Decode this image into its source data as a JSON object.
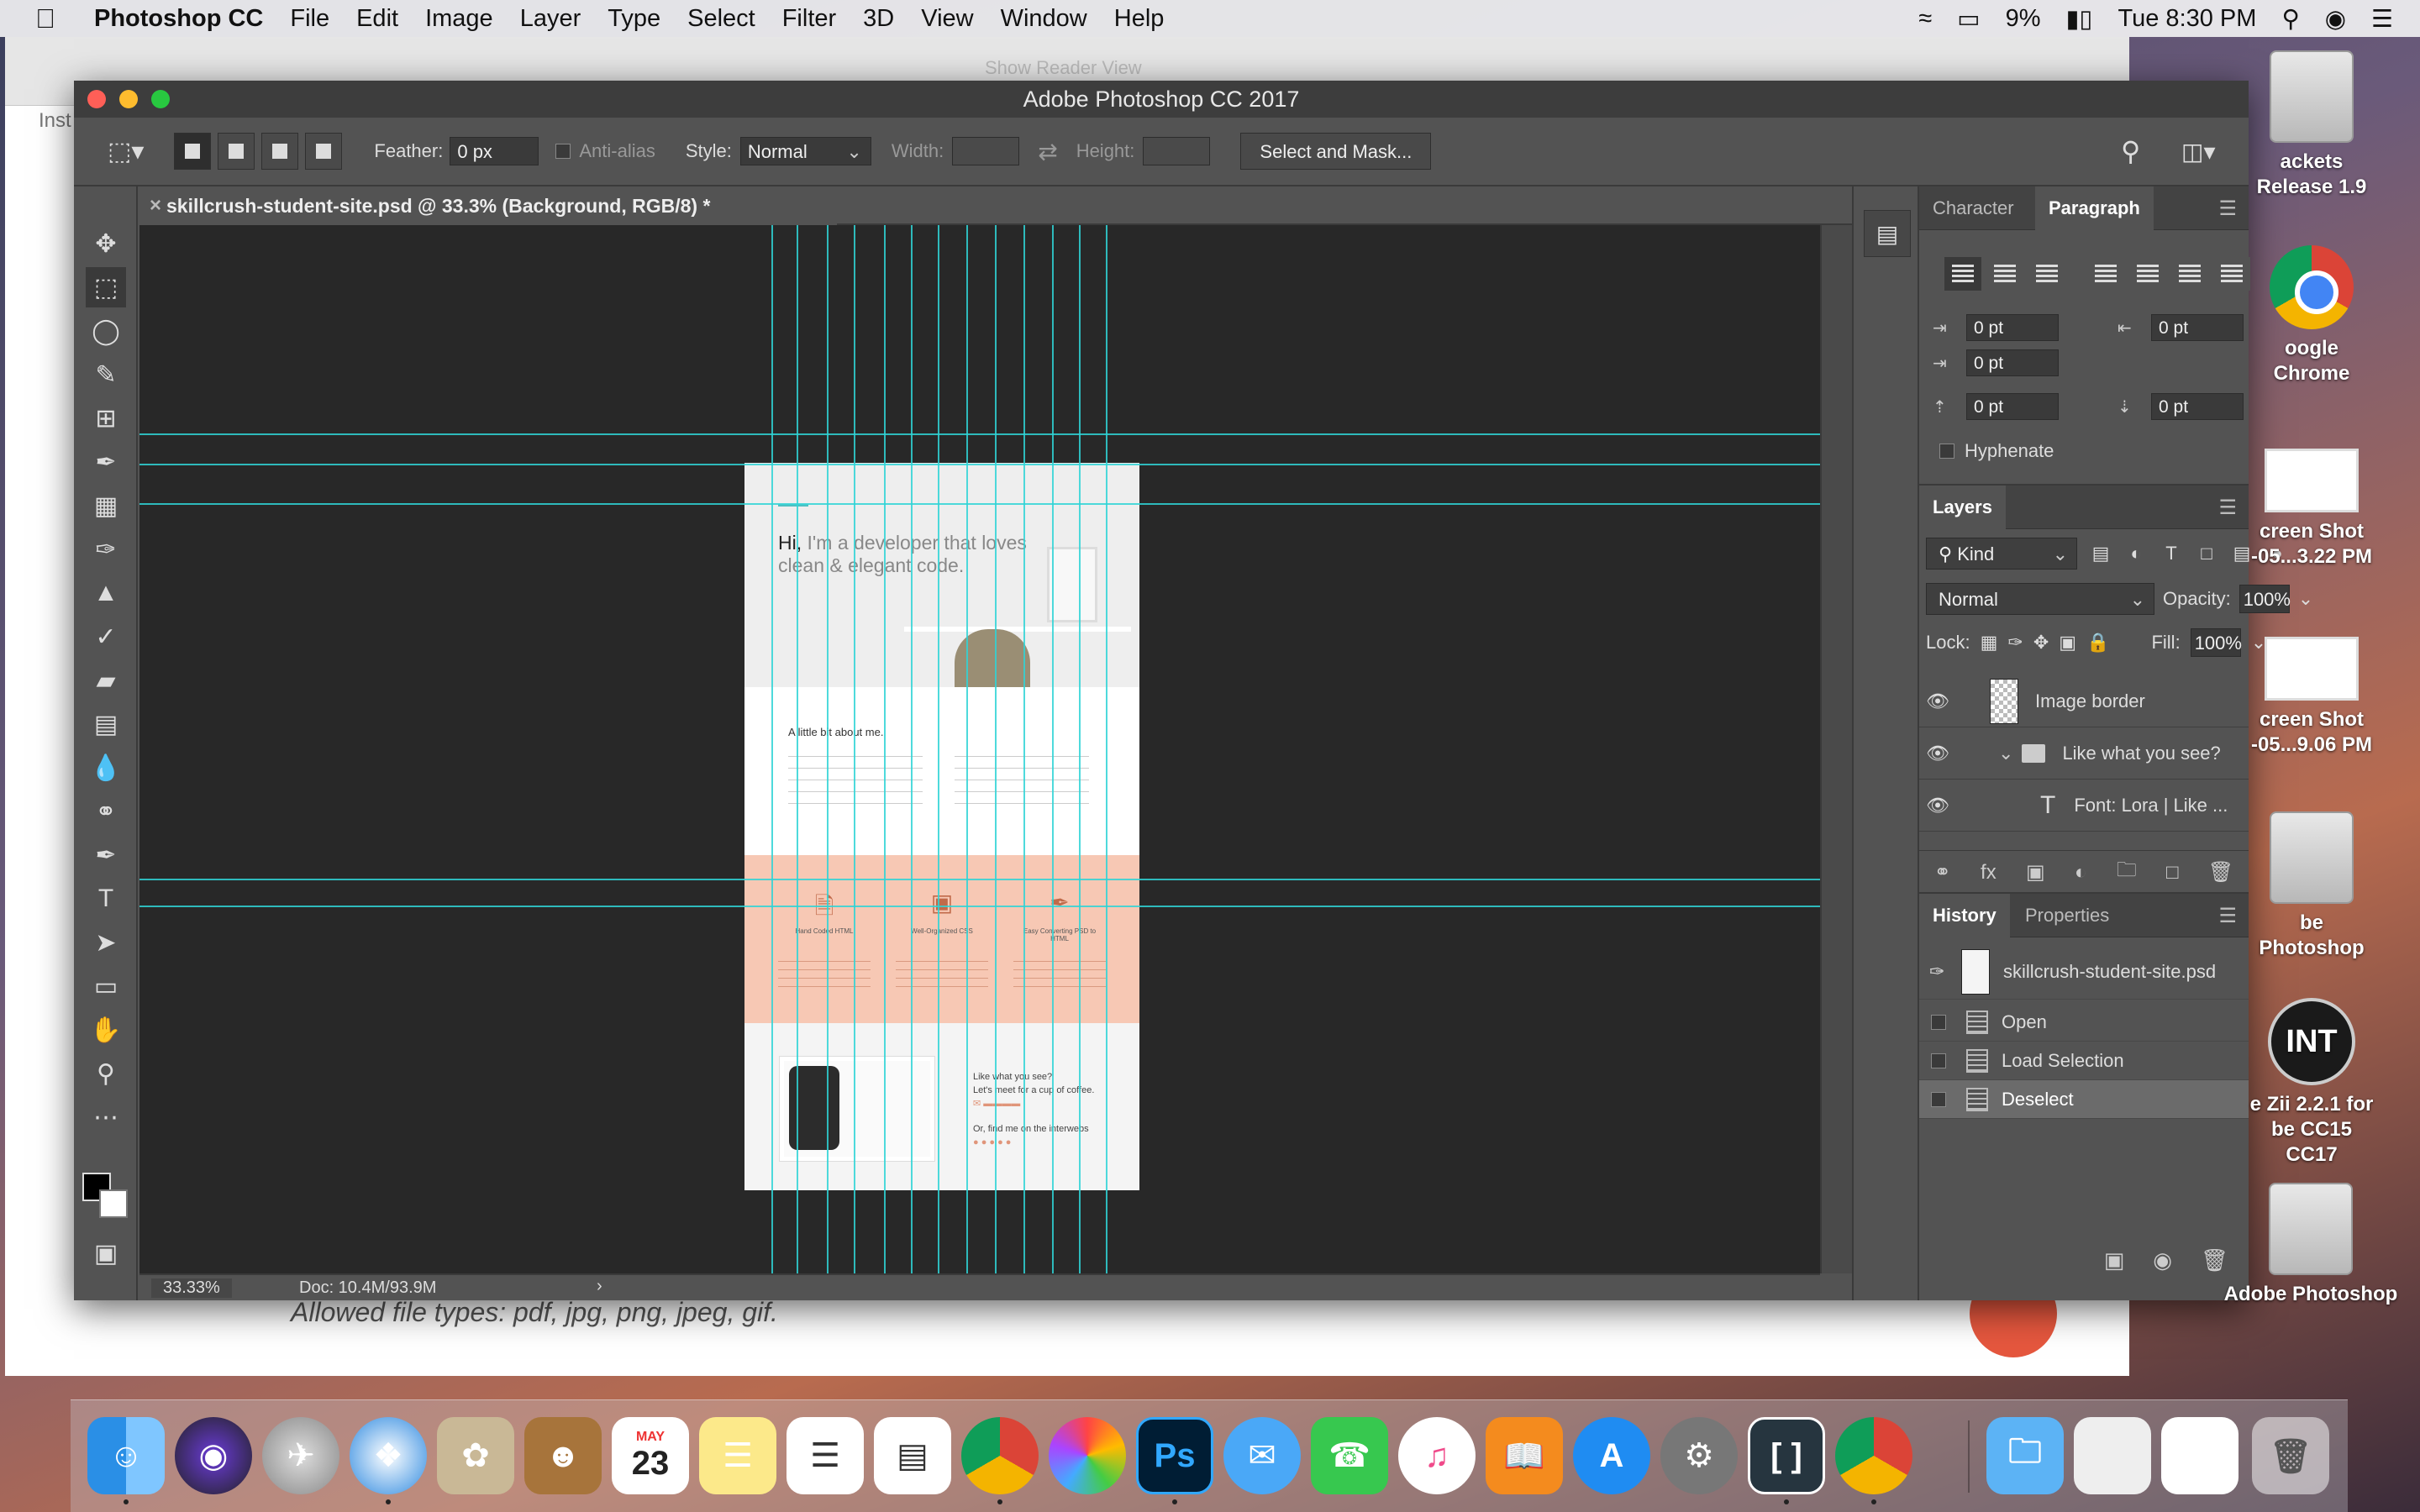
{
  "menubar": {
    "app_name": "Photoshop CC",
    "items": [
      "File",
      "Edit",
      "Image",
      "Layer",
      "Type",
      "Select",
      "Filter",
      "3D",
      "View",
      "Window",
      "Help"
    ],
    "battery": "9%",
    "clock": "Tue 8:30 PM"
  },
  "browser": {
    "reader_label": "Show Reader View",
    "tab_fragment": "Inst",
    "allowed_text": "Allowed file types: pdf, jpg, png, jpeg, gif."
  },
  "window": {
    "title": "Adobe Photoshop CC 2017"
  },
  "options": {
    "feather_label": "Feather:",
    "feather_value": "0 px",
    "antialias_label": "Anti-alias",
    "style_label": "Style:",
    "style_value": "Normal",
    "width_label": "Width:",
    "height_label": "Height:",
    "select_mask": "Select and Mask..."
  },
  "document": {
    "tab_title": "skillcrush-student-site.psd @ 33.3% (Background, RGB/8) *",
    "zoom": "33.33%",
    "doc_size": "Doc: 10.4M/93.9M"
  },
  "mockup": {
    "greeting_hi": "Hi,",
    "greeting_rest": "I'm a developer that loves clean & elegant code.",
    "about_heading": "A little bit about me.",
    "services": [
      "Hand Coded HTML",
      "Well-Organized CSS",
      "Easy Converting PSD to HTML"
    ],
    "contact_heading": "Like what you see?",
    "contact_sub": "Let's meet for a cup of coffee.",
    "contact_find": "Or, find me on the interwebs"
  },
  "character_panel": {
    "tab_character": "Character",
    "tab_paragraph": "Paragraph",
    "indent_left": "0 pt",
    "indent_right": "0 pt",
    "indent_first": "0 pt",
    "space_before": "0 pt",
    "space_after": "0 pt",
    "hyphenate_label": "Hyphenate"
  },
  "layers_panel": {
    "title": "Layers",
    "kind": "Kind",
    "blend_mode": "Normal",
    "opacity_label": "Opacity:",
    "opacity_value": "100%",
    "lock_label": "Lock:",
    "fill_label": "Fill:",
    "fill_value": "100%",
    "rows": [
      {
        "name": "Image border"
      },
      {
        "name": "Like what you see?"
      },
      {
        "name": "Font: Lora | Like ..."
      }
    ]
  },
  "history_panel": {
    "tab_history": "History",
    "tab_properties": "Properties",
    "snapshot": "skillcrush-student-site.psd",
    "states": [
      "Open",
      "Load Selection",
      "Deselect"
    ]
  },
  "desktop": {
    "icons": [
      {
        "label": "ackets Release 1.9"
      },
      {
        "label": "oogle Chrome"
      },
      {
        "label": "creen Shot -05...3.22 PM"
      },
      {
        "label": "creen Shot -05...9.06 PM"
      },
      {
        "label": "be Photoshop"
      },
      {
        "label": "e Zii 2.2.1 for be CC15 CC17"
      },
      {
        "label": "Adobe Photoshop"
      }
    ]
  },
  "dock": {
    "calendar_month": "MAY",
    "calendar_day": "23",
    "photoshop_label": "Ps"
  },
  "colors": {
    "guide": "#2fd3d6",
    "services_band": "#f7c8b4",
    "ps_ui": "#535353"
  }
}
